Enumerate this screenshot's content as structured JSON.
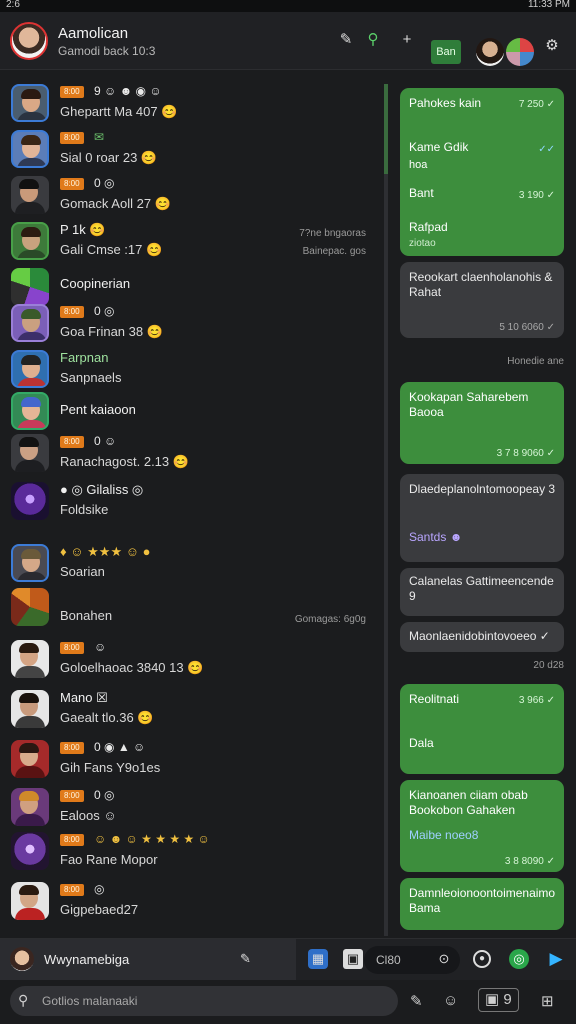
{
  "status": {
    "left": "2:6",
    "right": "11:33 PM"
  },
  "header": {
    "title": "Aamolican",
    "subtitle": "Gamodi back 10:3",
    "button_label": "Ban",
    "colors": {
      "accent": "#2f7d3a"
    }
  },
  "chats": [
    {
      "tag": "8:00",
      "emoji": "9 ☺ ☻ ◉ ☺",
      "line2": "Ghepartt Ma 407 😊"
    },
    {
      "tag": "8:00",
      "emoji": "✉",
      "line2": "Sial 0 roar 23 😊"
    },
    {
      "tag": "8:00",
      "emoji": "0 ◎",
      "line2": "Gomack Aoll 27 😊"
    },
    {
      "line1": "P 1k 😊",
      "line2": "Gali Cmse :17 😊",
      "meta1": "7?ne bngaoras",
      "meta2": "Bainepac. gos"
    },
    {
      "line1": "Coopinerian"
    },
    {
      "tag": "8:00",
      "emoji": "0 ◎",
      "line2": "Goa Frinan 38 😊"
    },
    {
      "line1": "Farpnan",
      "line2": "Sanpnaels"
    },
    {
      "line1": "Pent kaiaoon"
    },
    {
      "tag": "8:00",
      "emoji": "0 ☺",
      "line2": "Ranachagost. 2.13 😊"
    },
    {
      "line1": "● ◎ Gilaliss ◎",
      "line2": "Foldsike"
    },
    {
      "line1": "♦ ☺ ★★★ ☺ ●",
      "line2": "Soarian"
    },
    {
      "line1": "",
      "line2": "Bonahen",
      "meta2": "Gomagas: 6g0g"
    },
    {
      "tag": "8:00",
      "emoji": "☺",
      "line2": "Goloelhaoac 3840 13 😊"
    },
    {
      "line1": "Mano ☒",
      "line2": "Gaealt tlo.36 😊"
    },
    {
      "tag": "8:00",
      "emoji": "0 ◉ ▲ ☺",
      "line2": "Gih Fans Y9o1es"
    },
    {
      "tag": "8:00",
      "emoji": "0 ◎",
      "line2": "Ealoos ☺"
    },
    {
      "tag": "8:00",
      "emoji": "☺ ☻ ☺ ★ ★ ★ ★ ☺",
      "line2": "Fao Rane Mopor"
    },
    {
      "tag": "8:00",
      "emoji": "◎",
      "line2": "Gigpebaed27"
    }
  ],
  "messages": [
    {
      "dir": "out",
      "line": "Pahokes kain",
      "time": "7 250 ✓"
    },
    {
      "dir": "out",
      "line": "Kame Gdik",
      "line_b": "hoa",
      "time": "✓✓"
    },
    {
      "dir": "out",
      "line": "Bant",
      "time": "3 190 ✓"
    },
    {
      "dir": "out",
      "line": "Rafpad",
      "line_b": "ziotao"
    },
    {
      "dir": "in",
      "line": "Reookart claenholanohis & Rahat",
      "time": "5 10 6060 ✓"
    },
    {
      "day": "Honedie ane"
    },
    {
      "dir": "out",
      "line": "Kookapan Saharebem Baooa",
      "time": "3 7 8 9060 ✓"
    },
    {
      "dir": "in",
      "line": "Dlaedeplanolntomoopeay 3",
      "line_b": "Santds ☻"
    },
    {
      "dir": "in",
      "line": "Calanelas Gattimeencende 9"
    },
    {
      "dir": "in",
      "line": "Maonlaenidobintovoeeo ✓"
    },
    {
      "day": "20 d28"
    },
    {
      "dir": "out",
      "line": "Reolitnati",
      "line_b": "Dala",
      "time": "3 966 ✓"
    },
    {
      "dir": "out",
      "line": "Kianoanen ciiam obab Bookobon Gahaken",
      "line_b": "Maibe noeo8",
      "time": "3 8 8090 ✓"
    },
    {
      "dir": "out",
      "line": "Damnleoionoontoimenaimo Bama"
    }
  ],
  "composer": {
    "name": "Wwynamebiga",
    "input": "Cl80"
  },
  "search": {
    "placeholder": "Gotlios malanaaki"
  }
}
